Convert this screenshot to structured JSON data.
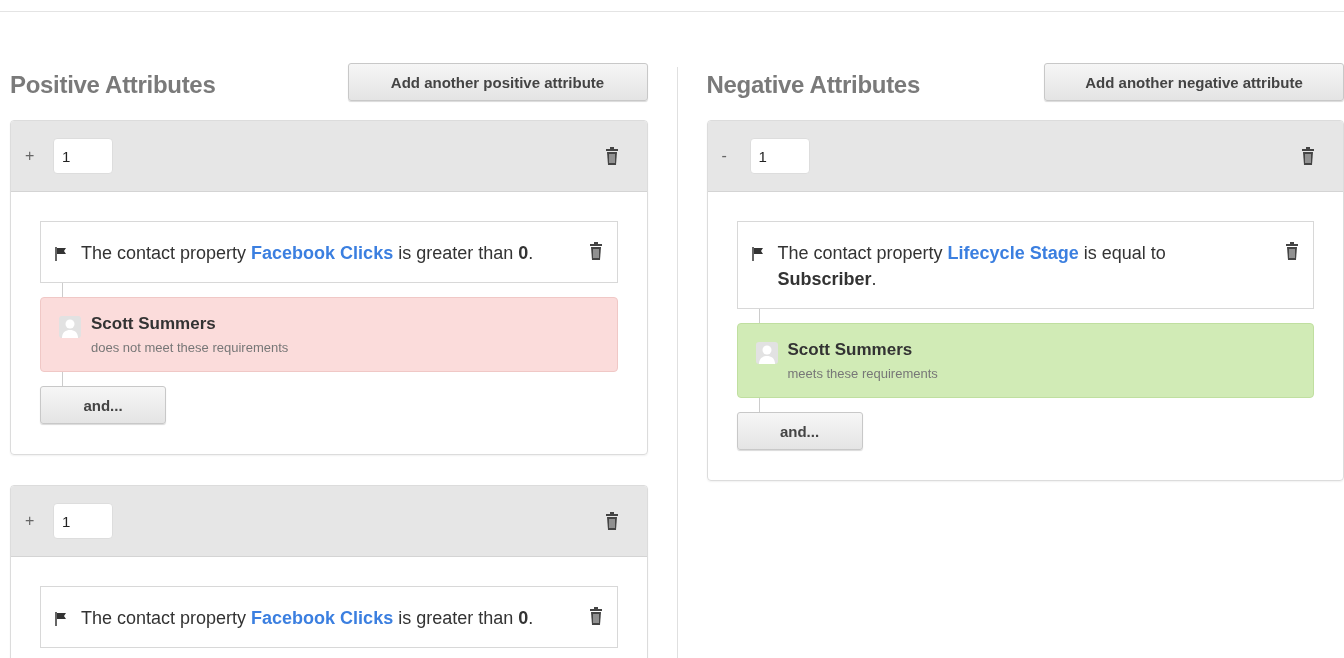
{
  "columns": [
    {
      "title": "Positive Attributes",
      "add_button": "Add another positive attribute",
      "cards": [
        {
          "sign": "+",
          "weight": "1",
          "conditions": [
            {
              "prefix": "The contact property",
              "property": "Facebook Clicks",
              "suffix": "is greater than **0**."
            }
          ],
          "result": {
            "meets": false,
            "name": "Scott Summers",
            "message": "does not meet these requirements"
          },
          "and_button": "and..."
        },
        {
          "sign": "+",
          "weight": "1",
          "conditions": [
            {
              "prefix": "The contact property",
              "property": "Facebook Clicks",
              "suffix": "is greater than **0**."
            }
          ]
        }
      ]
    },
    {
      "title": "Negative Attributes",
      "add_button": "Add another negative attribute",
      "cards": [
        {
          "sign": "-",
          "weight": "1",
          "conditions": [
            {
              "prefix": "The contact property",
              "property": "Lifecycle Stage",
              "suffix": "is equal to **Subscriber**."
            }
          ],
          "result": {
            "meets": true,
            "name": "Scott Summers",
            "message": "meets these requirements"
          },
          "and_button": "and..."
        }
      ]
    }
  ]
}
